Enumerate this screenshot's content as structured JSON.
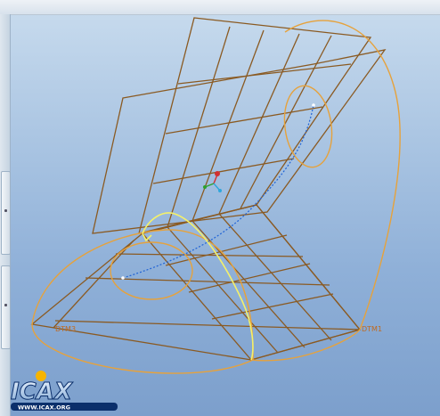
{
  "window": {
    "title": ""
  },
  "datums": {
    "left_label": "DTM3",
    "right_label": "DTM1"
  },
  "watermark": {
    "logo_text": "ICAX",
    "url_text": "WWW.ICAX.ORG"
  },
  "colors": {
    "background_top": "#c9dcee",
    "background_bottom": "#7c9fcc",
    "datum_plane": "#8a5a22",
    "sketch_arc": "#e6a23c",
    "highlight_curve": "#f4f06a",
    "trajectory": "#1f63d6"
  },
  "icons": {
    "triad": "coordinate-triad-icon",
    "logo": "icax-logo-icon"
  }
}
